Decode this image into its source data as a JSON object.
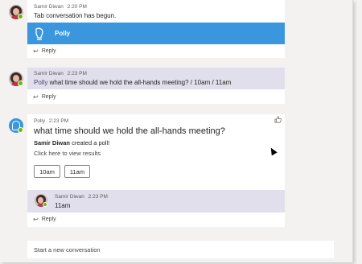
{
  "thread1": {
    "author": "Samir Diwan",
    "time": "2:20 PM",
    "text": "Tab conversation has begun.",
    "tab_name": "Polly",
    "reply_label": "Reply"
  },
  "thread2": {
    "author": "Samir Diwan",
    "time": "2:23 PM",
    "mention": "Polly",
    "text": " what time should we hold the all-hands meeting? / 10am / 11am",
    "reply_label": "Reply"
  },
  "thread3": {
    "author": "Polly",
    "time": "2:23 PM",
    "poll_title": "what time should we hold the all-hands meeting?",
    "creator": "Samir Diwan",
    "created_text": " created a poll!",
    "view_results": "Click here to view results",
    "options": [
      "10am",
      "11am"
    ],
    "reply": {
      "author": "Samir Diwan",
      "time": "2:23 PM",
      "text": "11am"
    },
    "reply_label": "Reply"
  },
  "composer": {
    "placeholder": "Start a new conversation"
  },
  "icons": {
    "reply": "reply-arrow-icon",
    "like": "thumbs-up-icon",
    "bot": "polly-bot-icon"
  },
  "colors": {
    "accent": "#3a96dd",
    "presence": "#6bb700",
    "reply_bg": "#e1dfec"
  }
}
